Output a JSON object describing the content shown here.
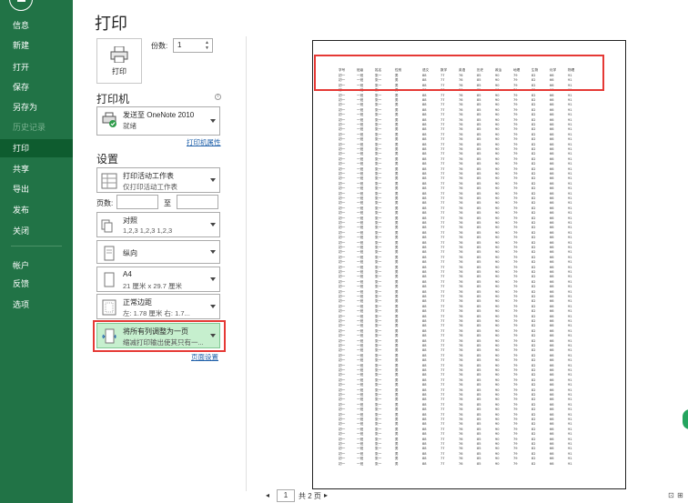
{
  "sidebar": {
    "items": [
      {
        "label": "信息",
        "state": "normal"
      },
      {
        "label": "新建",
        "state": "normal"
      },
      {
        "label": "打开",
        "state": "normal"
      },
      {
        "label": "保存",
        "state": "normal"
      },
      {
        "label": "另存为",
        "state": "normal"
      },
      {
        "label": "历史记录",
        "state": "disabled"
      },
      {
        "label": "打印",
        "state": "active"
      },
      {
        "label": "共享",
        "state": "normal"
      },
      {
        "label": "导出",
        "state": "normal"
      },
      {
        "label": "发布",
        "state": "normal"
      },
      {
        "label": "关闭",
        "state": "normal"
      },
      {
        "label": "帐户",
        "state": "normal"
      },
      {
        "label": "反馈",
        "state": "normal"
      },
      {
        "label": "选项",
        "state": "normal"
      }
    ]
  },
  "print": {
    "title": "打印",
    "print_button": "打印",
    "copies_label": "份数:",
    "copies_value": "1"
  },
  "printer": {
    "section_title": "打印机",
    "name": "发送至 OneNote 2010",
    "status": "就绪",
    "properties_link": "打印机属性"
  },
  "settings": {
    "section_title": "设置",
    "what": {
      "line1": "打印活动工作表",
      "line2": "仅打印活动工作表"
    },
    "pages_label": "页数:",
    "pages_to": "至",
    "collate": {
      "line1": "对照",
      "line2": "1,2,3    1,2,3    1,2,3"
    },
    "orientation": {
      "line1": "纵向"
    },
    "paper": {
      "line1": "A4",
      "line2": "21 厘米 x 29.7 厘米"
    },
    "margins": {
      "line1": "正常边距",
      "line2": "左: 1.78 厘米   右: 1.7..."
    },
    "scaling": {
      "line1": "将所有列调整为一页",
      "line2": "缩减打印输出使其只有一..."
    },
    "page_setup_link": "页面设置"
  },
  "preview": {
    "pager_current": "1",
    "pager_total": "共 2 页",
    "headers": [
      "学号",
      "班级",
      "姓名",
      "性别",
      "语文",
      "数学",
      "英语",
      "历史",
      "政治",
      "地理",
      "生物",
      "化学",
      "物理"
    ],
    "row_sample": [
      "初一",
      "一班",
      "张一",
      "男",
      "88",
      "77",
      "76",
      "85",
      "90",
      "79",
      "82",
      "66",
      "91"
    ],
    "row_count": 80
  },
  "colors": {
    "brand_green": "#217346",
    "active_nav": "#0e5c2f",
    "highlight_green": "#c6efce",
    "annotation_red": "#e53935"
  }
}
